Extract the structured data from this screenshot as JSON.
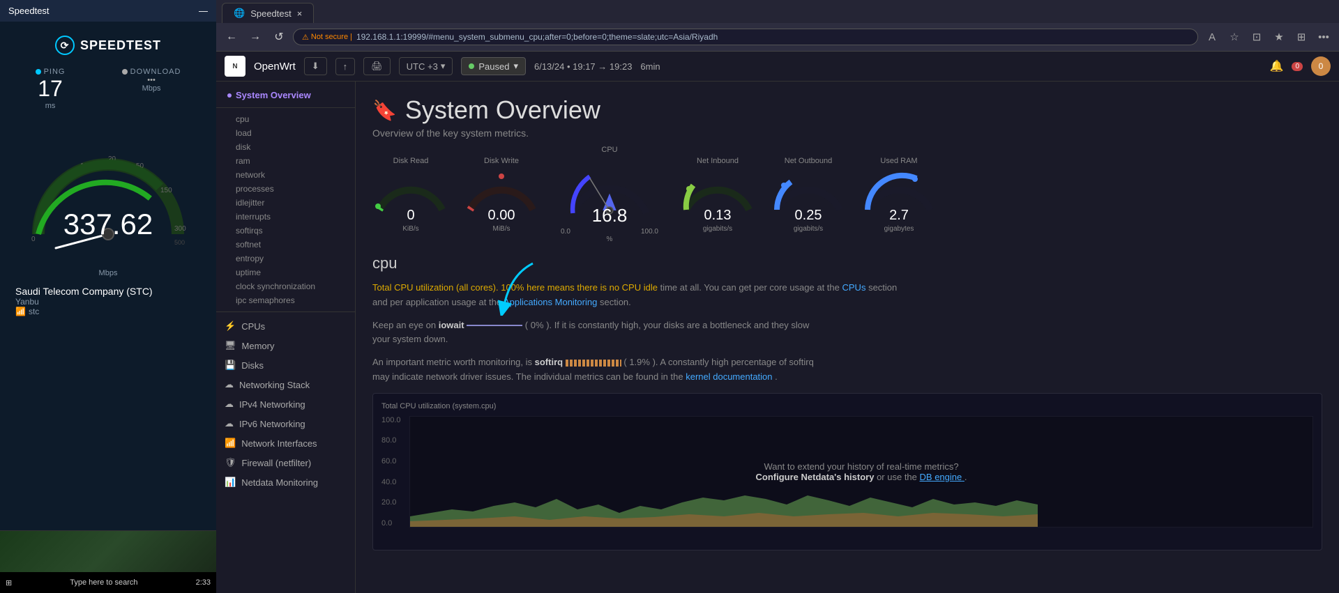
{
  "speedtest": {
    "title": "Speedtest",
    "ping": {
      "label": "PING",
      "value": "17",
      "unit": "ms"
    },
    "download": {
      "label": "DOWNLOAD",
      "value": "337.62",
      "unit": "Mbps",
      "mbps_label": "Mbps"
    },
    "speed_display": "337.62",
    "provider": {
      "name": "Saudi Telecom Company (STC)",
      "city": "Yanbu",
      "isp": "stc"
    },
    "time": "2:33"
  },
  "browser": {
    "tab_label": "Speedtest",
    "nav": {
      "secure_badge": "Not secure",
      "url": "192.168.1.1:19999/#menu_system_submenu_cpu;after=0;before=0;theme=slate;utc=Asia/Riyadh"
    },
    "toolbar": {
      "logo": "",
      "openwrt_label": "OpenWrt",
      "download_icon": "⬇",
      "share_icon": "↑",
      "print_icon": "🖨",
      "timezone": "UTC +3",
      "paused_label": "Paused",
      "time_range": "6/13/24 • 19:17 → 19:23",
      "duration": "6min",
      "bell_icon": "🔔",
      "notif_count": "0",
      "user_badge": "0"
    }
  },
  "netdata": {
    "page_title": "System Overview",
    "page_subtitle": "Overview of the key system metrics.",
    "sidebar": {
      "current_section": "System Overview",
      "items": [
        {
          "label": "System Overview",
          "active": true
        },
        {
          "label": "cpu"
        },
        {
          "label": "load"
        },
        {
          "label": "disk"
        },
        {
          "label": "ram"
        },
        {
          "label": "network"
        },
        {
          "label": "processes"
        },
        {
          "label": "idlejitter"
        },
        {
          "label": "interrupts"
        },
        {
          "label": "softirqs"
        },
        {
          "label": "softnet"
        },
        {
          "label": "entropy"
        },
        {
          "label": "uptime"
        },
        {
          "label": "clock synchronization"
        },
        {
          "label": "ipc semaphores"
        }
      ],
      "icon_items": [
        {
          "label": "CPUs",
          "icon": "⚡"
        },
        {
          "label": "Memory",
          "icon": "🖥"
        },
        {
          "label": "Disks",
          "icon": "💾"
        },
        {
          "label": "Networking Stack",
          "icon": "☁"
        },
        {
          "label": "IPv4 Networking",
          "icon": "☁"
        },
        {
          "label": "IPv6 Networking",
          "icon": "☁"
        },
        {
          "label": "Network Interfaces",
          "icon": "📶"
        },
        {
          "label": "Firewall (netfilter)",
          "icon": "🛡"
        },
        {
          "label": "Netdata Monitoring",
          "icon": "📊"
        }
      ]
    },
    "gauges": {
      "disk_read": {
        "title": "Disk Read",
        "value": "0",
        "unit": "KiB/s",
        "color": "#44cc44",
        "dot_color": "#44cc44"
      },
      "disk_write": {
        "title": "Disk Write",
        "value": "0.00",
        "unit": "MiB/s",
        "color": "#cc4444",
        "dot_color": "#cc4444"
      },
      "cpu": {
        "title": "CPU",
        "value": "16.8",
        "min": "0.0",
        "max": "100.0",
        "unit": "%"
      },
      "net_inbound": {
        "title": "Net Inbound",
        "value": "0.13",
        "unit": "gigabits/s",
        "color": "#44cc44"
      },
      "net_outbound": {
        "title": "Net Outbound",
        "value": "0.25",
        "unit": "gigabits/s",
        "color": "#44aaff"
      },
      "used_ram": {
        "title": "Used RAM",
        "value": "2.7",
        "unit": "gigabytes",
        "color": "#44aaff"
      }
    },
    "cpu_section": {
      "title": "cpu",
      "desc1": "Total CPU utilization (all cores). 100% here means there is no CPU idle time at all. You can get per core usage at the",
      "cpus_link": "CPUs",
      "desc2": "section",
      "desc3": "and per application usage at the",
      "app_link": "Applications Monitoring",
      "desc4": "section.",
      "iowait_label": "iowait",
      "iowait_pct": "0%",
      "softirq_label": "softirq",
      "softirq_pct": "1.9%",
      "chart_label": "Total CPU utilization (system.cpu)",
      "y_axis": [
        "100.0",
        "80.0",
        "60.0",
        "40.0",
        "20.0",
        "0.0"
      ],
      "cta_text": "Want to extend your history of real-time metrics?",
      "cta_bold": "Configure Netdata's history",
      "cta_mid": "or use the",
      "cta_link": "DB engine",
      "cta_end": "."
    }
  }
}
